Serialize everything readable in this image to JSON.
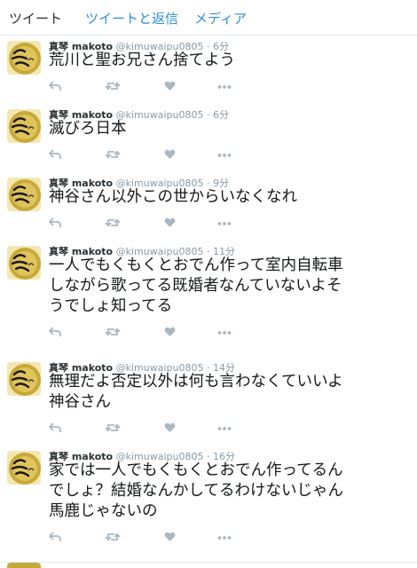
{
  "tabs": [
    {
      "label": "ツイート"
    },
    {
      "label": "ツイートと返信"
    },
    {
      "label": "メディア"
    }
  ],
  "colors": {
    "link": "#2b8fd6",
    "muted": "#8899a6",
    "action": "#aab8c2",
    "avatar_gold": "#c7a93a"
  },
  "icons": [
    "reply-icon",
    "retweet-icon",
    "like-icon",
    "more-icon"
  ],
  "tweets": [
    {
      "fullname": "真琴 makoto",
      "username": "@kimuwaipu0805",
      "time": "· 6分",
      "lines": [
        "荒川と聖お兄さん捨てよう"
      ]
    },
    {
      "fullname": "真琴 makoto",
      "username": "@kimuwaipu0805",
      "time": "· 6分",
      "lines": [
        "滅びろ日本"
      ]
    },
    {
      "fullname": "真琴 makoto",
      "username": "@kimuwaipu0805",
      "time": "· 9分",
      "lines": [
        "神谷さん以外この世からいなくなれ"
      ]
    },
    {
      "fullname": "真琴 makoto",
      "username": "@kimuwaipu0805",
      "time": "· 11分",
      "lines": [
        "一人でもくもくとおでん作って室内自転車",
        "しながら歌ってる既婚者なんていないよそ",
        "うでしょ知ってる"
      ]
    },
    {
      "fullname": "真琴 makoto",
      "username": "@kimuwaipu0805",
      "time": "· 14分",
      "lines": [
        "無理だよ否定以外は何も言わなくていいよ",
        "神谷さん"
      ]
    },
    {
      "fullname": "真琴 makoto",
      "username": "@kimuwaipu0805",
      "time": "· 16分",
      "lines": [
        "家では一人でもくもくとおでん作ってるん",
        "でしょ？結婚なんかしてるわけないじゃん",
        "馬鹿じゃないの"
      ]
    }
  ]
}
